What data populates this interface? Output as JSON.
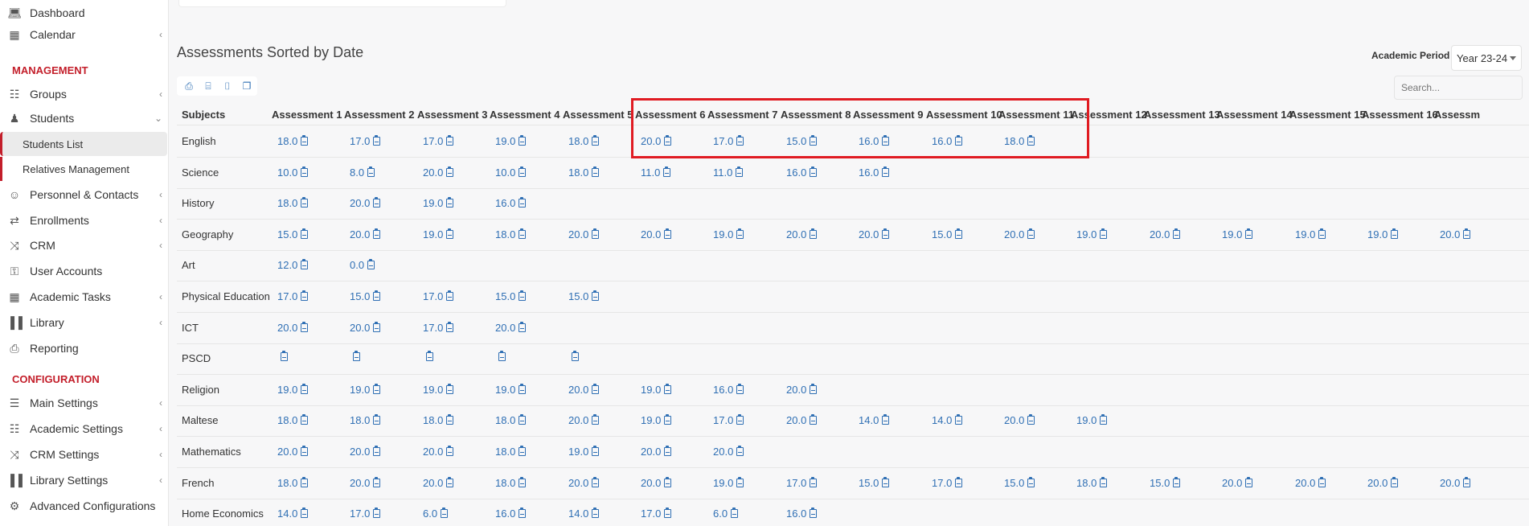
{
  "sidebar": {
    "top_items": [
      {
        "label": "Dashboard",
        "icon": "laptop-icon"
      },
      {
        "label": "Calendar",
        "icon": "calendar-icon"
      }
    ],
    "section_management": "MANAGEMENT",
    "management_items": [
      {
        "label": "Groups",
        "icon": "groups-icon"
      },
      {
        "label": "Students",
        "icon": "students-icon"
      },
      {
        "label": "Students List"
      },
      {
        "label": "Relatives Management"
      },
      {
        "label": "Personnel & Contacts",
        "icon": "person-icon"
      },
      {
        "label": "Enrollments",
        "icon": "exchange-icon"
      },
      {
        "label": "CRM",
        "icon": "shuffle-icon"
      },
      {
        "label": "User Accounts",
        "icon": "key-icon"
      },
      {
        "label": "Academic Tasks",
        "icon": "grid-icon"
      },
      {
        "label": "Library",
        "icon": "books-icon"
      },
      {
        "label": "Reporting",
        "icon": "printer-icon"
      }
    ],
    "section_configuration": "CONFIGURATION",
    "configuration_items": [
      {
        "label": "Main Settings",
        "icon": "sliders-icon"
      },
      {
        "label": "Academic Settings",
        "icon": "hierarchy-icon"
      },
      {
        "label": "CRM Settings",
        "icon": "shuffle-icon"
      },
      {
        "label": "Library Settings",
        "icon": "books-icon"
      },
      {
        "label": "Advanced Configurations",
        "icon": "gears-icon"
      }
    ]
  },
  "main": {
    "title": "Assessments Sorted by Date",
    "academic_period_label": "Academic Period",
    "academic_period_value": "Year 23-24",
    "search_placeholder": "Search...",
    "tools": [
      "print-icon",
      "excel-icon",
      "csv-icon",
      "copy-icon"
    ]
  },
  "table": {
    "subjects_header": "Subjects",
    "columns": [
      "Assessment 1",
      "Assessment 2",
      "Assessment 3",
      "Assessment 4",
      "Assessment 5",
      "Assessment 6",
      "Assessment 7",
      "Assessment 8",
      "Assessment 9",
      "Assessment 10",
      "Assessment 11",
      "Assessment 12",
      "Assessment 13",
      "Assessment 14",
      "Assessment 15",
      "Assessment 16",
      "Assessm"
    ],
    "rows": [
      {
        "subject": "English",
        "scores": [
          "18.0",
          "17.0",
          "17.0",
          "19.0",
          "18.0",
          "20.0",
          "17.0",
          "15.0",
          "16.0",
          "16.0",
          "18.0"
        ]
      },
      {
        "subject": "Science",
        "scores": [
          "10.0",
          "8.0",
          "20.0",
          "10.0",
          "18.0",
          "11.0",
          "11.0",
          "16.0",
          "16.0"
        ]
      },
      {
        "subject": "History",
        "scores": [
          "18.0",
          "20.0",
          "19.0",
          "16.0"
        ]
      },
      {
        "subject": "Geography",
        "scores": [
          "15.0",
          "20.0",
          "19.0",
          "18.0",
          "20.0",
          "20.0",
          "19.0",
          "20.0",
          "20.0",
          "15.0",
          "20.0",
          "19.0",
          "20.0",
          "19.0",
          "19.0",
          "19.0",
          "20.0"
        ]
      },
      {
        "subject": "Art",
        "scores": [
          "12.0",
          "0.0"
        ]
      },
      {
        "subject": "Physical Education",
        "scores": [
          "17.0",
          "15.0",
          "17.0",
          "15.0",
          "15.0"
        ]
      },
      {
        "subject": "ICT",
        "scores": [
          "20.0",
          "20.0",
          "17.0",
          "20.0"
        ]
      },
      {
        "subject": "PSCD",
        "scores": [
          "",
          "",
          "",
          "",
          ""
        ]
      },
      {
        "subject": "Religion",
        "scores": [
          "19.0",
          "19.0",
          "19.0",
          "19.0",
          "20.0",
          "19.0",
          "16.0",
          "20.0"
        ]
      },
      {
        "subject": "Maltese",
        "scores": [
          "18.0",
          "18.0",
          "18.0",
          "18.0",
          "20.0",
          "19.0",
          "17.0",
          "20.0",
          "14.0",
          "14.0",
          "20.0",
          "19.0"
        ]
      },
      {
        "subject": "Mathematics",
        "scores": [
          "20.0",
          "20.0",
          "20.0",
          "18.0",
          "19.0",
          "20.0",
          "20.0"
        ]
      },
      {
        "subject": "French",
        "scores": [
          "18.0",
          "20.0",
          "20.0",
          "18.0",
          "20.0",
          "20.0",
          "19.0",
          "17.0",
          "15.0",
          "17.0",
          "15.0",
          "18.0",
          "15.0",
          "20.0",
          "20.0",
          "20.0",
          "20.0"
        ]
      },
      {
        "subject": "Home Economics",
        "scores": [
          "14.0",
          "17.0",
          "6.0",
          "16.0",
          "14.0",
          "17.0",
          "6.0",
          "16.0"
        ]
      }
    ]
  },
  "colors": {
    "accent_red": "#c31e2a",
    "link_blue": "#2f6fb4",
    "highlight_red": "#e01b22"
  }
}
